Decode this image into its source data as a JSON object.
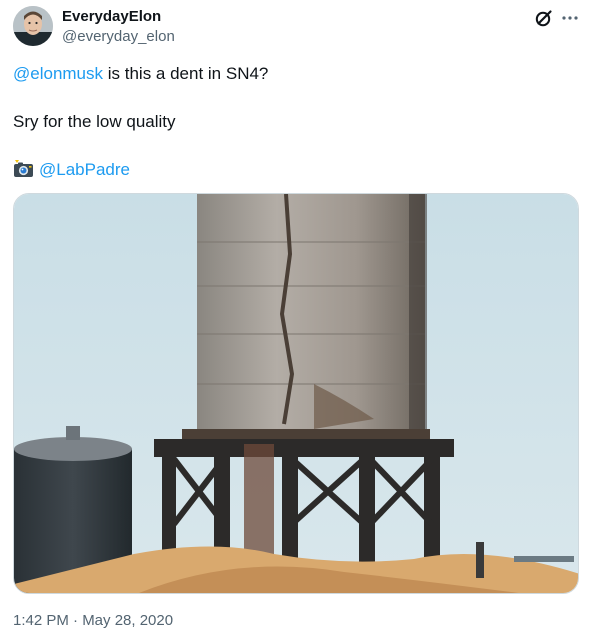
{
  "author": {
    "name": "EverydayElon",
    "handle": "@everyday_elon",
    "avatar_icon": "profile-photo"
  },
  "header_actions": {
    "grok_icon": "grok-icon",
    "more_icon": "more-options-icon"
  },
  "tweet": {
    "line1_mention": "@elonmusk",
    "line1_text": " is this a dent in SN4?",
    "line2_text": "Sry for the low quality",
    "line3_icon": "camera-with-flash-icon",
    "line3_mention": "@LabPadre"
  },
  "media": {
    "type": "photo",
    "subject": "SN4"
  },
  "timestamp": "1:42 PM · May 28, 2020",
  "colors": {
    "link": "#1d9bf0",
    "secondary_text": "#536471",
    "primary_text": "#0f1419"
  }
}
